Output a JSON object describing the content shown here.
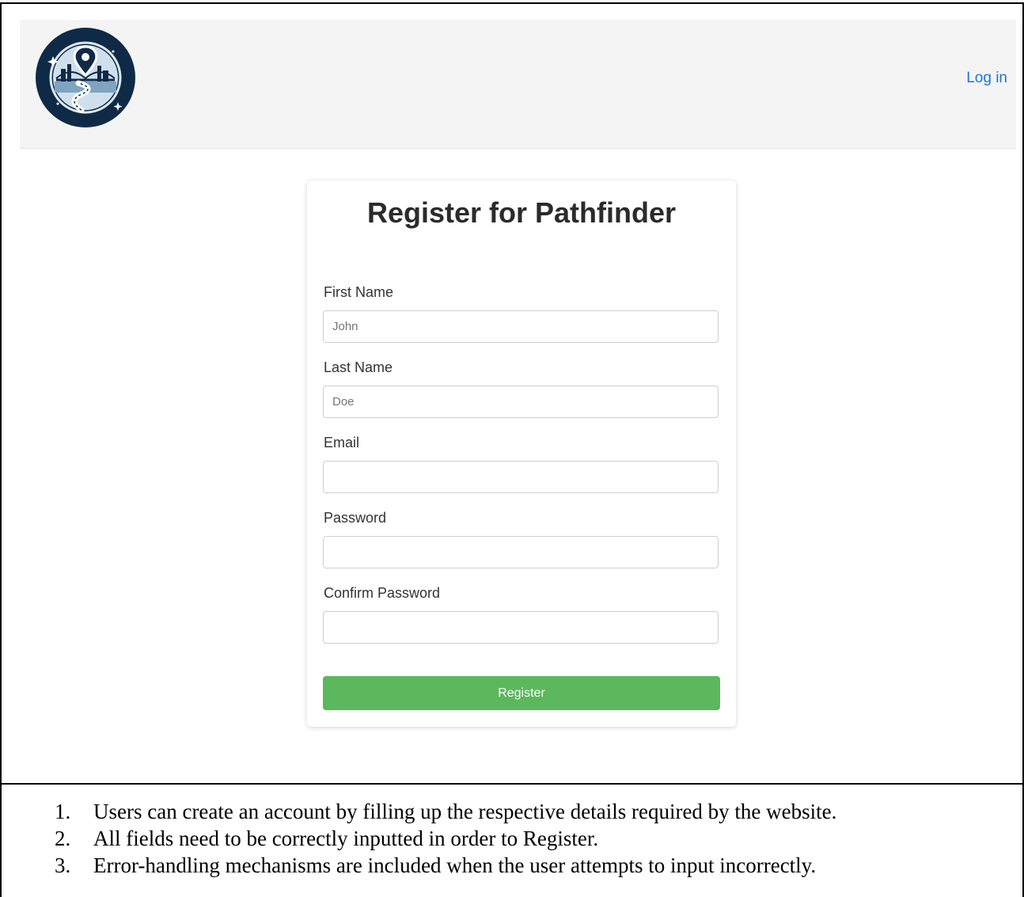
{
  "navbar": {
    "login_label": "Log in",
    "logo_icon": "pathfinder-logo-icon"
  },
  "form": {
    "title": "Register for Pathfinder",
    "fields": [
      {
        "label": "First Name",
        "placeholder": "John",
        "value": ""
      },
      {
        "label": "Last Name",
        "placeholder": "Doe",
        "value": ""
      },
      {
        "label": "Email",
        "placeholder": "",
        "value": ""
      },
      {
        "label": "Password",
        "placeholder": "",
        "value": ""
      },
      {
        "label": "Confirm Password",
        "placeholder": "",
        "value": ""
      }
    ],
    "submit_label": "Register",
    "submit_color": "#5cb85c"
  },
  "notes": [
    {
      "num": "1.",
      "text": "Users can create an account by filling up the respective details required by the website."
    },
    {
      "num": "2.",
      "text": "All fields need to be correctly inputted in order to Register."
    },
    {
      "num": "3.",
      "text": "Error-handling mechanisms are included when the user attempts to input incorrectly."
    }
  ],
  "colors": {
    "link": "#1a73e8",
    "navbar_bg": "#f4f4f4",
    "logo_bg": "#0f2a47"
  }
}
